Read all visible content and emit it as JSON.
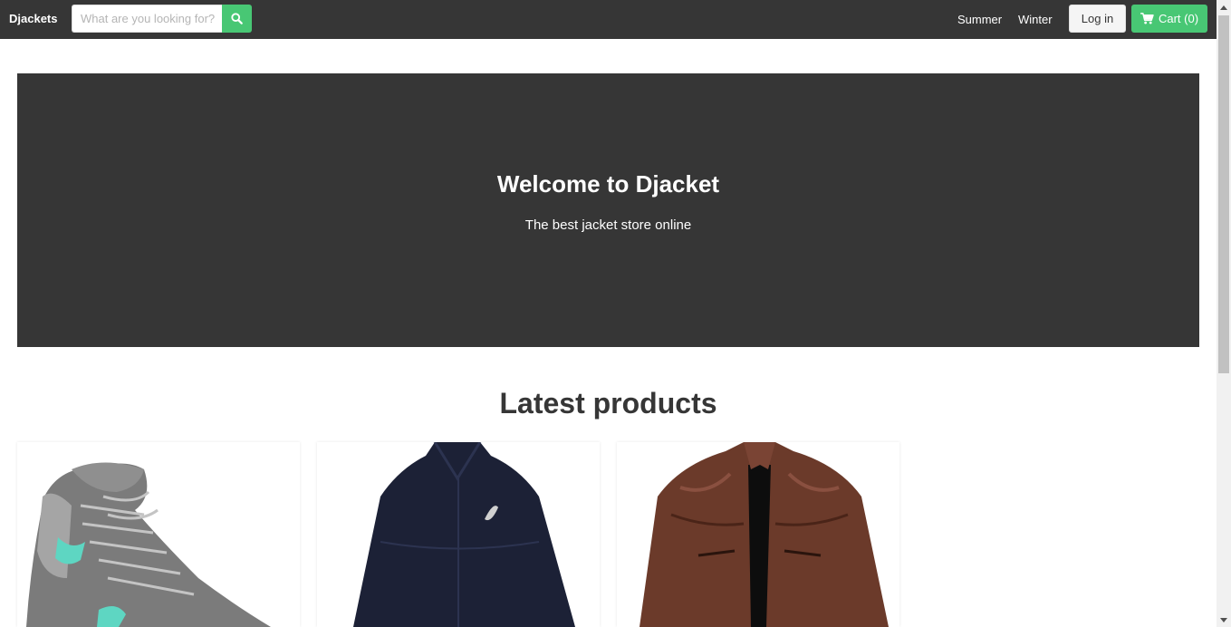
{
  "navbar": {
    "brand": "Djackets",
    "search": {
      "placeholder": "What are you looking for?",
      "value": "",
      "icon": "search-icon"
    },
    "links": [
      "Summer",
      "Winter"
    ],
    "login_label": "Log in",
    "cart_label": "Cart (0)",
    "cart_icon": "shopping-cart-icon"
  },
  "hero": {
    "title": "Welcome to Djacket",
    "subtitle": "The best jacket store online"
  },
  "main": {
    "section_title": "Latest products",
    "products": [
      {
        "image": "grey-winter-boot"
      },
      {
        "image": "navy-asics-zip-jacket"
      },
      {
        "image": "brown-leather-jacket"
      }
    ]
  },
  "colors": {
    "dark": "#363636",
    "accent": "#48c774",
    "white": "#ffffff"
  }
}
